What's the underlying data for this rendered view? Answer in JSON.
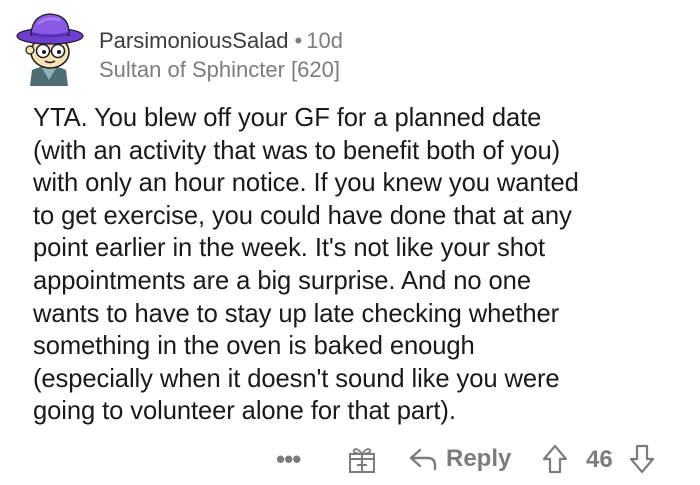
{
  "comment": {
    "username": "ParsimoniousSalad",
    "separator": "•",
    "age": "10d",
    "flair": "Sultan of Sphincter [620]",
    "body_lines": [
      "YTA. You blew off your GF for a planned date",
      "(with an activity that was to benefit both of you)",
      "with only an hour notice. If you knew you wanted",
      "to get exercise, you could have done that at any",
      "point earlier in the week. It's not like your shot",
      "appointments are a big surprise. And no one",
      "wants to have to stay up late checking whether",
      "something in the oven is baked enough",
      "(especially when it doesn't sound like you were",
      "going to volunteer alone for that part)."
    ]
  },
  "actions": {
    "more_label": "•••",
    "reply_label": "Reply",
    "score": "46"
  },
  "icons": {
    "avatar": "snoo-avatar-purple-hat",
    "more": "more-dots-icon",
    "award": "gift-award-icon",
    "reply": "reply-arrow-icon",
    "upvote": "upvote-arrow-icon",
    "downvote": "downvote-arrow-icon"
  },
  "colors": {
    "text": "#1a1a1b",
    "meta": "#7c7c7c",
    "hat": "#6e3fd1",
    "hat_light": "#a77df2"
  }
}
